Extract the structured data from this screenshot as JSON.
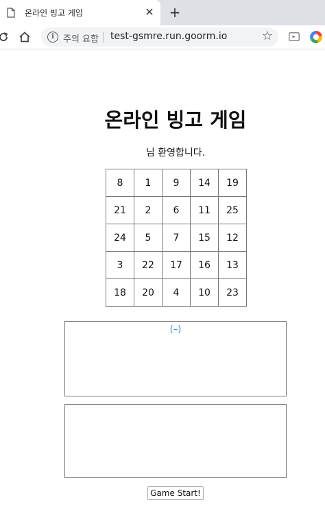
{
  "browser": {
    "tab_title": "온라인 빙고 게임",
    "close_glyph": "✕",
    "new_tab_glyph": "+",
    "security_label": "주의 요함",
    "url": "test-gsmre.run.goorm.io",
    "star_glyph": "☆",
    "info_glyph": "i"
  },
  "page": {
    "title": "온라인 빙고 게임",
    "welcome": "님 환영합니다.",
    "board": [
      [
        "8",
        "1",
        "9",
        "14",
        "19"
      ],
      [
        "21",
        "2",
        "6",
        "11",
        "25"
      ],
      [
        "24",
        "5",
        "7",
        "15",
        "12"
      ],
      [
        "3",
        "22",
        "17",
        "16",
        "13"
      ],
      [
        "18",
        "20",
        "4",
        "10",
        "23"
      ]
    ],
    "status": "(–)",
    "start_button": "Game Start!"
  },
  "colors": {
    "status_text": "#2b8fd6",
    "tabstrip": "#dee1e6",
    "omnibox": "#f1f3f4"
  }
}
